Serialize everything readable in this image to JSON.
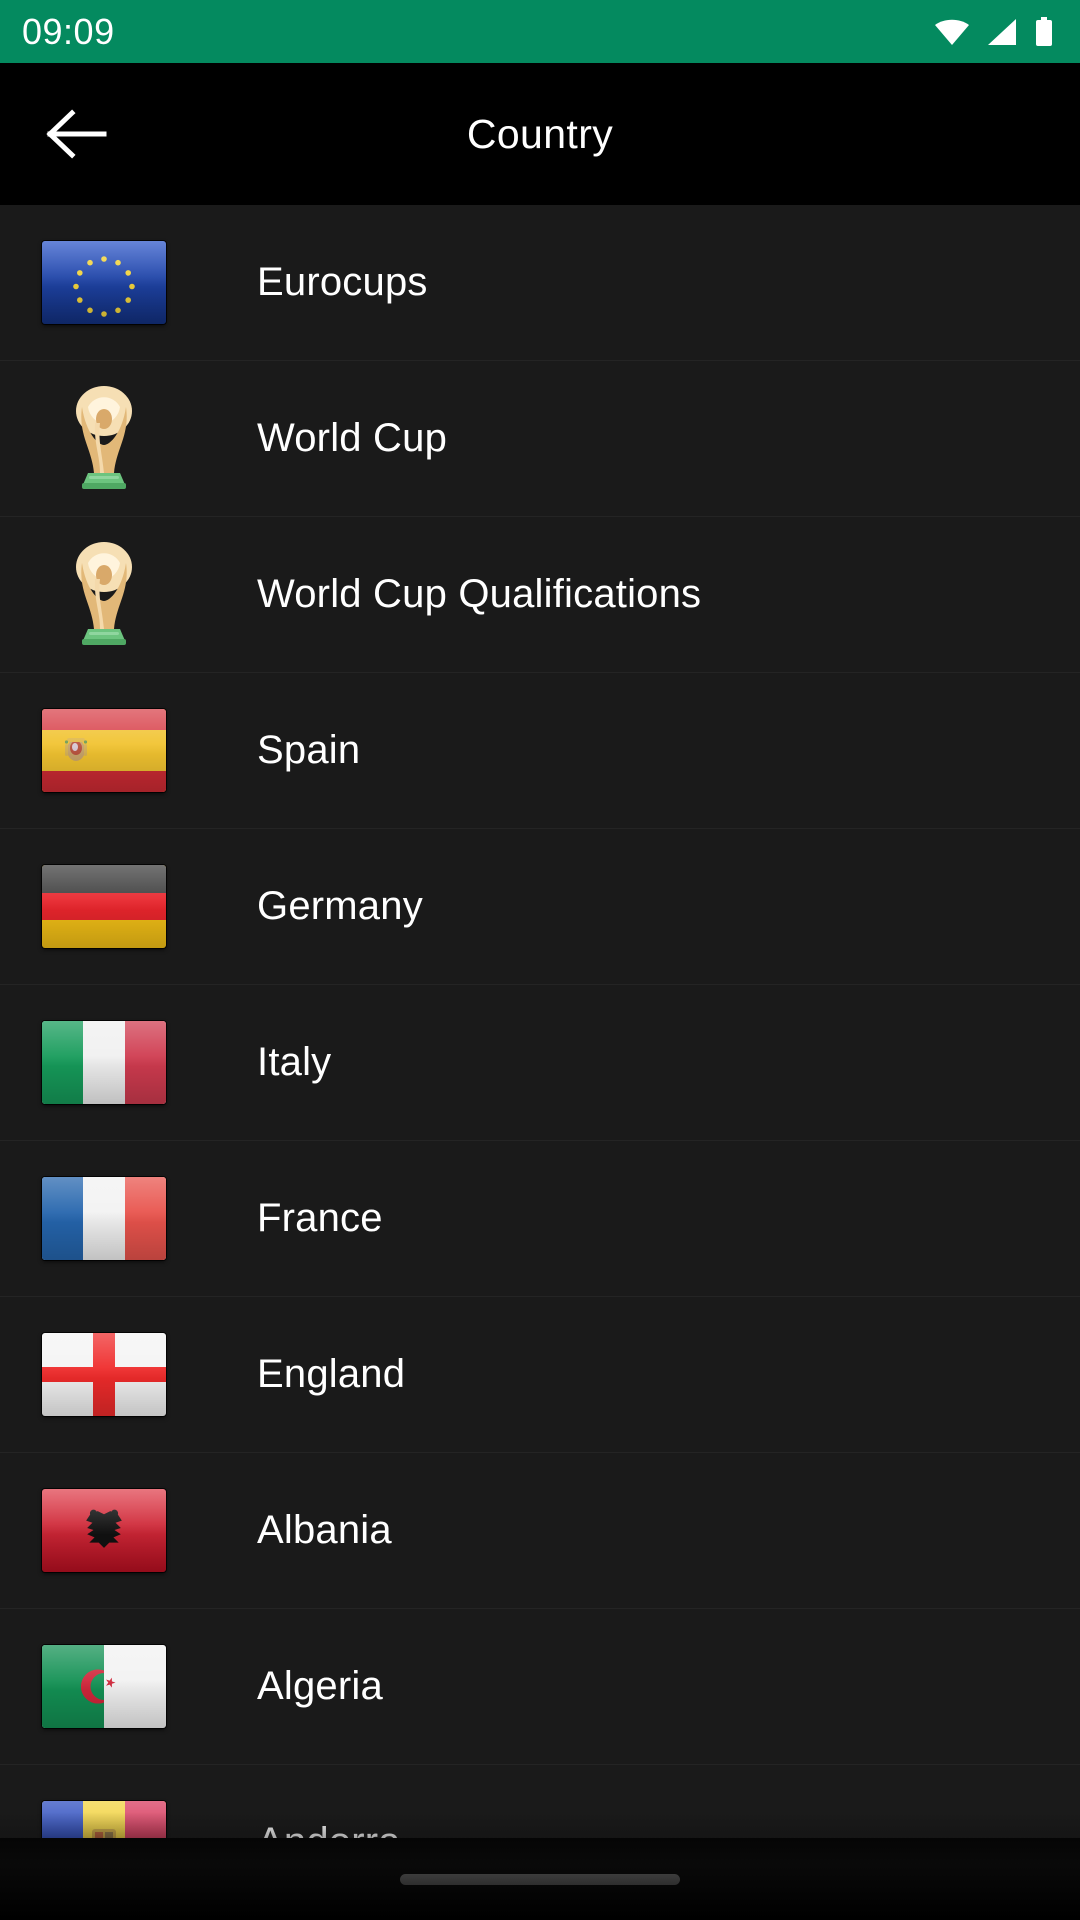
{
  "statusbar": {
    "time": "09:09",
    "background": "#048a5f",
    "icons": [
      "wifi-icon",
      "cellular-signal-icon",
      "battery-icon"
    ]
  },
  "header": {
    "title": "Country",
    "back_label": "back-arrow",
    "background": "#000000"
  },
  "list": {
    "background": "#1a1a1a",
    "text_color": "#ffffff",
    "items": [
      {
        "label": "Eurocups",
        "icon": "flag-eu",
        "type": "flag"
      },
      {
        "label": "World Cup",
        "icon": "trophy",
        "type": "trophy"
      },
      {
        "label": "World Cup Qualifications",
        "icon": "trophy",
        "type": "trophy"
      },
      {
        "label": "Spain",
        "icon": "flag-spain",
        "type": "flag"
      },
      {
        "label": "Germany",
        "icon": "flag-germany",
        "type": "flag"
      },
      {
        "label": "Italy",
        "icon": "flag-italy",
        "type": "flag"
      },
      {
        "label": "France",
        "icon": "flag-france",
        "type": "flag"
      },
      {
        "label": "England",
        "icon": "flag-england",
        "type": "flag"
      },
      {
        "label": "Albania",
        "icon": "flag-albania",
        "type": "flag"
      },
      {
        "label": "Algeria",
        "icon": "flag-algeria",
        "type": "flag"
      },
      {
        "label": "Andorra",
        "icon": "flag-andorra",
        "type": "flag"
      }
    ]
  },
  "navbar": {
    "home_indicator": "home-indicator"
  }
}
